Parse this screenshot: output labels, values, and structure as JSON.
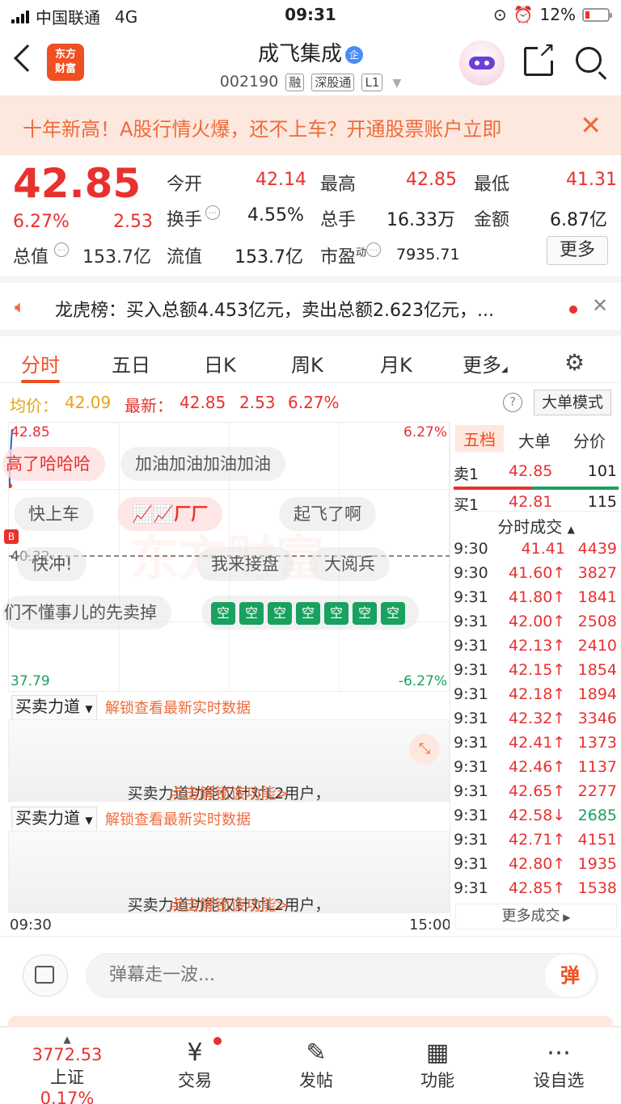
{
  "status": {
    "carrier": "中国联通",
    "network": "4G",
    "time": "09:31",
    "battery": "12%"
  },
  "header": {
    "stock_name": "成飞集成",
    "ent_badge": "企",
    "code": "002190",
    "tags": [
      "融",
      "深股通",
      "L1"
    ],
    "logo_line1": "东方",
    "logo_line2": "财富"
  },
  "banner": {
    "text": "十年新高！A股行情火爆，还不上车？开通股票账户立即"
  },
  "quote": {
    "price": "42.85",
    "change_pct": "6.27%",
    "change": "2.53",
    "open_label": "今开",
    "open": "42.14",
    "high_label": "最高",
    "high": "42.85",
    "low_label": "最低",
    "low": "41.31",
    "turnover_label": "换手",
    "turnover": "4.55%",
    "volume_label": "总手",
    "volume": "16.33万",
    "amount_label": "金额",
    "amount": "6.87亿",
    "total_value_label": "总值",
    "total_value": "153.7亿",
    "float_value_label": "流值",
    "float_value": "153.7亿",
    "pe_label": "市盈",
    "pe_sup": "动",
    "pe": "7935.71",
    "more_button": "更多"
  },
  "dragon": {
    "text": "龙虎榜：买入总额4.453亿元，卖出总额2.623亿元，..."
  },
  "tabs": [
    "分时",
    "五日",
    "日K",
    "周K",
    "月K",
    "更多"
  ],
  "avgrow": {
    "avg_label": "均价：",
    "avg": "42.09",
    "latest_label": "最新：",
    "latest": "42.85",
    "change": "2.53",
    "pct": "6.27%",
    "big_order_button": "大单模式"
  },
  "chart": {
    "top_price": "42.85",
    "mid_price": "40.32",
    "bottom_price": "37.79",
    "top_pct": "6.27%",
    "bottom_pct": "-6.27%",
    "start_time": "09:30",
    "end_time": "15:00",
    "buy_mark": "B",
    "watermark": "东方财富",
    "bullets": [
      "高了哈哈哈",
      "加油加油加油加油",
      "快上车",
      "起飞了啊",
      "快冲!",
      "我来接盘",
      "大阅兵",
      "们不懂事儿的先卖掉"
    ],
    "kong_char": "空"
  },
  "force": {
    "select": "买卖力道",
    "unlock_link": "解锁查看最新实时数据",
    "body_text": "买卖力道功能仅针对L2用户，",
    "body_link": "点击解锁该功能>"
  },
  "orderbook": {
    "tabs": [
      "五档",
      "大单",
      "分价"
    ],
    "sell1": {
      "label": "卖1",
      "price": "42.85",
      "vol": "101"
    },
    "buy1": {
      "label": "买1",
      "price": "42.81",
      "vol": "115"
    },
    "trades_title": "分时成交",
    "trades": [
      {
        "t": "9:30",
        "p": "41.41",
        "v": "4439",
        "dir": ""
      },
      {
        "t": "9:30",
        "p": "41.60↑",
        "v": "3827",
        "dir": "up"
      },
      {
        "t": "9:31",
        "p": "41.80↑",
        "v": "1841",
        "dir": "up"
      },
      {
        "t": "9:31",
        "p": "42.00↑",
        "v": "2508",
        "dir": "up"
      },
      {
        "t": "9:31",
        "p": "42.13↑",
        "v": "2410",
        "dir": "up"
      },
      {
        "t": "9:31",
        "p": "42.15↑",
        "v": "1854",
        "dir": "up"
      },
      {
        "t": "9:31",
        "p": "42.18↑",
        "v": "1894",
        "dir": "up"
      },
      {
        "t": "9:31",
        "p": "42.32↑",
        "v": "3346",
        "dir": "up"
      },
      {
        "t": "9:31",
        "p": "42.41↑",
        "v": "1373",
        "dir": "up"
      },
      {
        "t": "9:31",
        "p": "42.46↑",
        "v": "1137",
        "dir": "up"
      },
      {
        "t": "9:31",
        "p": "42.65↑",
        "v": "2277",
        "dir": "up"
      },
      {
        "t": "9:31",
        "p": "42.58↓",
        "v": "2685",
        "dir": "down"
      },
      {
        "t": "9:31",
        "p": "42.71↑",
        "v": "4151",
        "dir": "up"
      },
      {
        "t": "9:31",
        "p": "42.80↑",
        "v": "1935",
        "dir": "up"
      },
      {
        "t": "9:31",
        "p": "42.85↑",
        "v": "1538",
        "dir": "up"
      }
    ],
    "more_trades": "更多成交"
  },
  "danmu": {
    "placeholder": "弹幕走一波...",
    "send": "弹"
  },
  "bottom": {
    "index_value": "3772.53",
    "index_name": "上证",
    "index_pct": "0.17%",
    "items": [
      "交易",
      "发帖",
      "功能",
      "设自选"
    ]
  },
  "colors": {
    "up": "#e8312f",
    "down": "#19a15f",
    "accent": "#f04e23"
  }
}
